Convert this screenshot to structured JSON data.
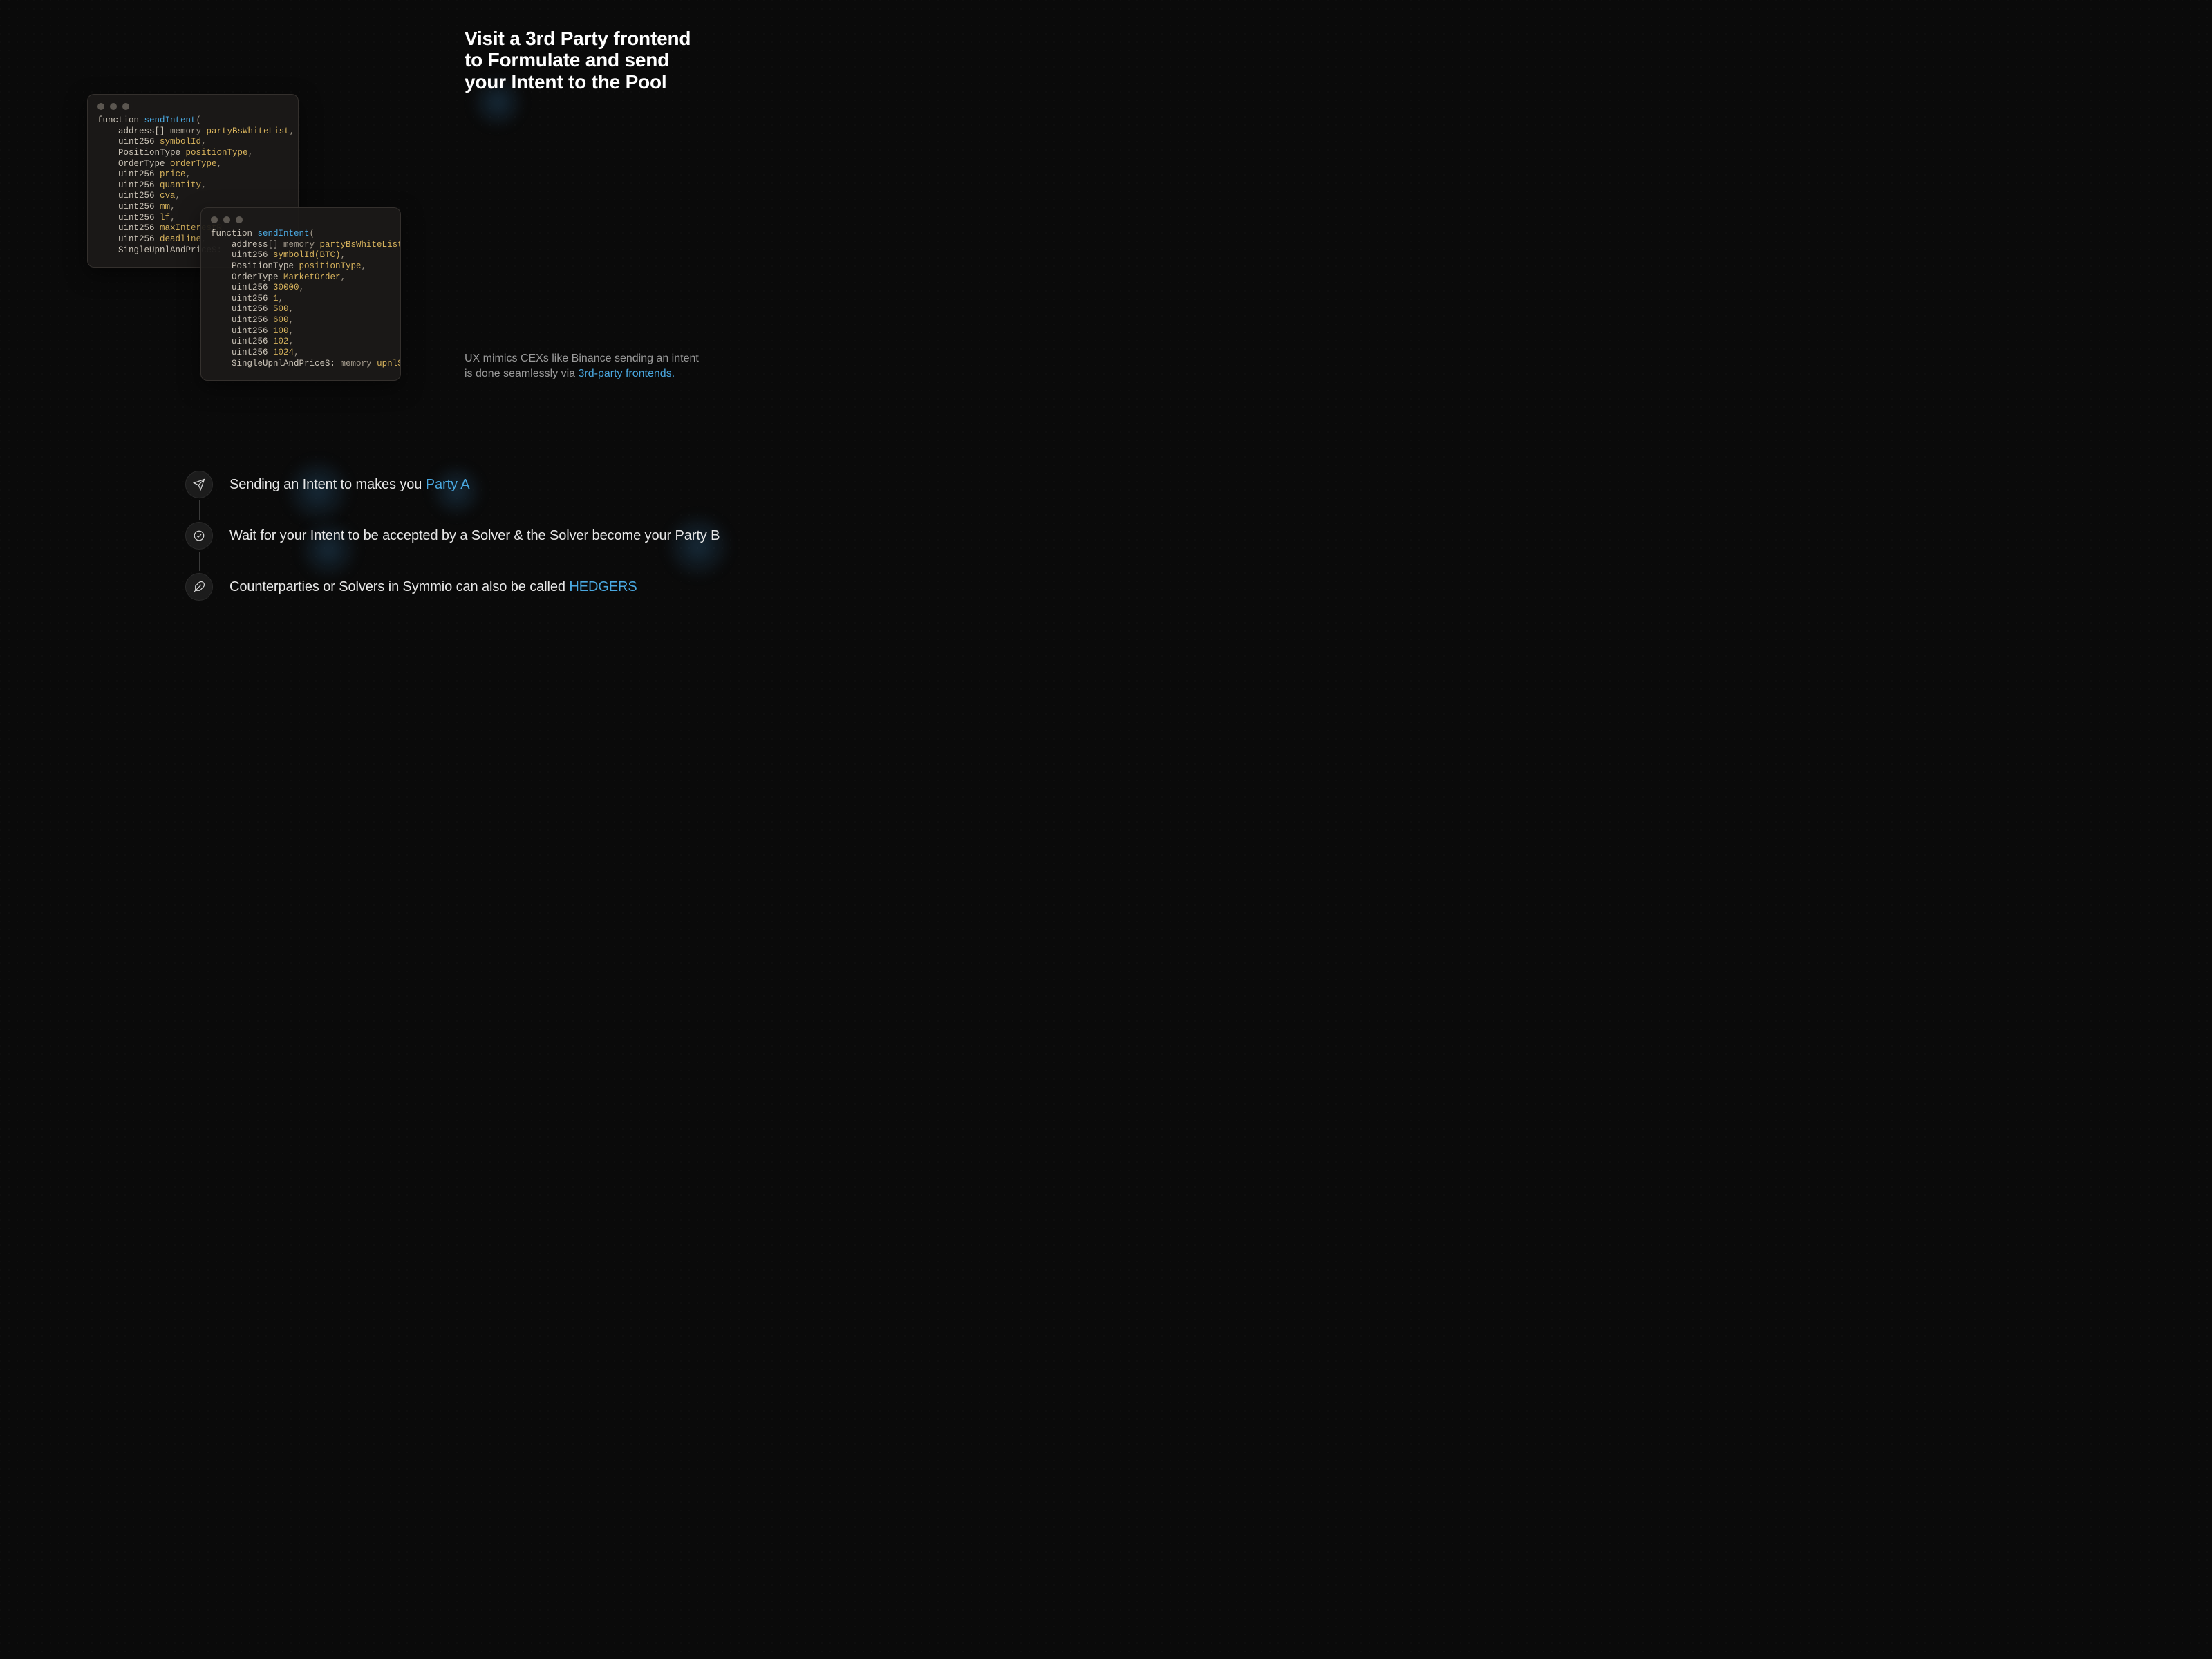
{
  "hero": {
    "title": "Visit a 3rd Party frontend to Formulate and send your Intent to the Pool",
    "desc_pre": "UX mimics CEXs like Binance sending an intent is done seamlessly via ",
    "desc_hl": "3rd-party frontends.",
    "desc_post": ""
  },
  "code_a": {
    "kw_fn": "function ",
    "fn_name": "sendIntent",
    "open": "(",
    "lines": [
      {
        "ty": "address[]",
        "mem": " memory ",
        "id": "partyBsWhiteList",
        "p": ","
      },
      {
        "ty": "uint256",
        "mem": " ",
        "id": "symbolId",
        "p": ","
      },
      {
        "ty": "PositionType",
        "mem": " ",
        "id": "positionType",
        "p": ","
      },
      {
        "ty": "OrderType",
        "mem": " ",
        "id": "orderType",
        "p": ","
      },
      {
        "ty": "uint256",
        "mem": " ",
        "id": "price",
        "p": ","
      },
      {
        "ty": "uint256",
        "mem": " ",
        "id": "quantity",
        "p": ","
      },
      {
        "ty": "uint256",
        "mem": " ",
        "id": "cva",
        "p": ","
      },
      {
        "ty": "uint256",
        "mem": " ",
        "id": "mm",
        "p": ","
      },
      {
        "ty": "uint256",
        "mem": " ",
        "id": "lf",
        "p": ","
      },
      {
        "ty": "uint256",
        "mem": " ",
        "id": "maxInterestR",
        "p": ""
      },
      {
        "ty": "uint256",
        "mem": " ",
        "id": "deadline",
        "p": ","
      },
      {
        "ty": "SingleUpnlAndPriceS:",
        "mem": "",
        "id": "",
        "p": ""
      }
    ]
  },
  "code_b": {
    "kw_fn": "function ",
    "fn_name": "sendIntent",
    "open": "(",
    "lines": [
      {
        "ty": "address[]",
        "mem": " memory ",
        "id": "partyBsWhiteList",
        "p": ","
      },
      {
        "ty": "uint256",
        "mem": " ",
        "id": "symbolId(BTC)",
        "p": ","
      },
      {
        "ty": "PositionType",
        "mem": " ",
        "id": "positionType",
        "p": ","
      },
      {
        "ty": "OrderType",
        "mem": " ",
        "id": "MarketOrder",
        "p": ","
      },
      {
        "ty": "uint256",
        "mem": " ",
        "id": "30000",
        "p": ","
      },
      {
        "ty": "uint256",
        "mem": " ",
        "id": "1",
        "p": ","
      },
      {
        "ty": "uint256",
        "mem": " ",
        "id": "500",
        "p": ","
      },
      {
        "ty": "uint256",
        "mem": " ",
        "id": "600",
        "p": ","
      },
      {
        "ty": "uint256",
        "mem": " ",
        "id": "100",
        "p": ","
      },
      {
        "ty": "uint256",
        "mem": " ",
        "id": "102",
        "p": ","
      },
      {
        "ty": "uint256",
        "mem": " ",
        "id": "1024",
        "p": ","
      },
      {
        "ty": "SingleUpnlAndPriceS:",
        "mem": " memory ",
        "id": "upnlSig",
        "p": ""
      }
    ]
  },
  "steps": [
    {
      "pre": "Sending an Intent to makes you ",
      "hl": "Party A",
      "post": ""
    },
    {
      "pre": "Wait for your Intent to be accepted by a Solver & the Solver become your Party B",
      "hl": "",
      "post": ""
    },
    {
      "pre": "Counterparties or Solvers in Symmio can also be called ",
      "hl": "HEDGERS",
      "post": ""
    }
  ]
}
